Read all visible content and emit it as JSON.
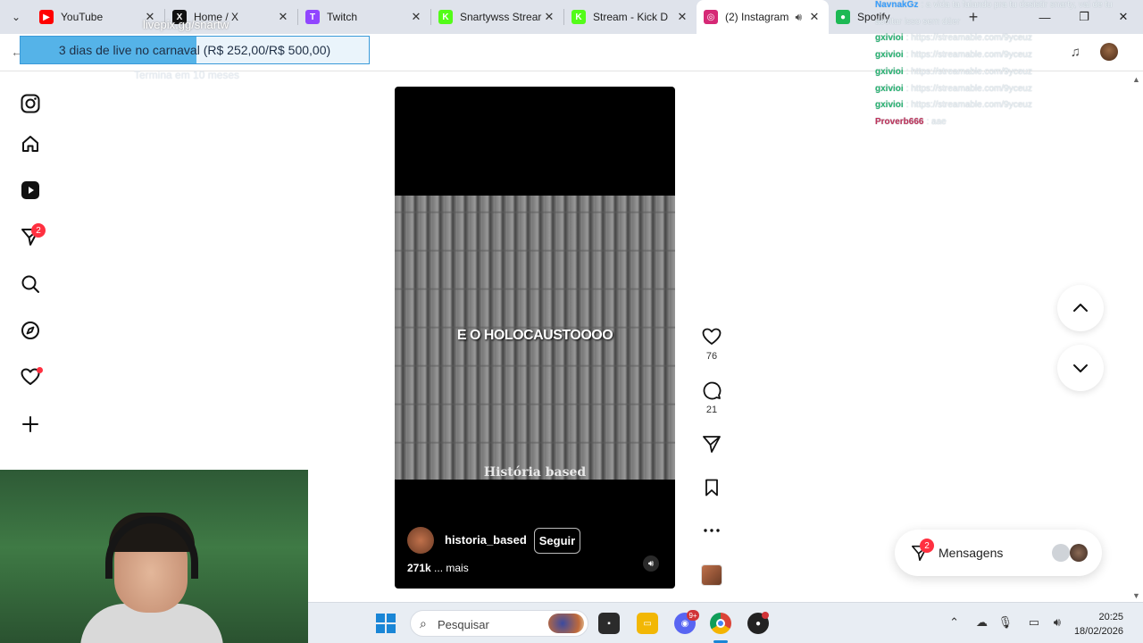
{
  "browser": {
    "tabs": [
      {
        "title": "YouTube",
        "color": "#ff0000",
        "glyph": "▶"
      },
      {
        "title": "Home / X",
        "color": "#111111",
        "glyph": "X"
      },
      {
        "title": "Twitch",
        "color": "#9146ff",
        "glyph": "T"
      },
      {
        "title": "Snartywss Strear",
        "color": "#53fc18",
        "glyph": "K"
      },
      {
        "title": "Stream - Kick D",
        "color": "#53fc18",
        "glyph": "K"
      },
      {
        "title": "(2) Instagram",
        "color": "#d62976",
        "glyph": "◎"
      },
      {
        "title": "Spotify",
        "color": "#1db954",
        "glyph": "●"
      }
    ],
    "active_tab_index": 5
  },
  "overlay": {
    "goal_text": "3 dias de live no carnaval (R$ 252,00/R$ 500,00)",
    "goal_progress": 0.504,
    "goal_sub": "Termina em 10 meses",
    "url_text": "livepix.gg/snartw",
    "goal_color": "#55b3e8"
  },
  "chat": [
    {
      "user": "NavnakGz",
      "text": "a vida ta falando pra tu desistir snarty, vai de tu",
      "color": "#3aa0ff"
    },
    {
      "user": "",
      "text": "aceitar isso sem dúer",
      "color": "#3aa0ff"
    },
    {
      "user": "gxivioi",
      "text": "https://streamable.com/9yceuz",
      "color": "#2bb673"
    },
    {
      "user": "gxivioi",
      "text": "https://streamable.com/9yceuz",
      "color": "#2bb673"
    },
    {
      "user": "gxivioi",
      "text": "https://streamable.com/9yceuz",
      "color": "#2bb673"
    },
    {
      "user": "gxivioi",
      "text": "https://streamable.com/9yceuz",
      "color": "#2bb673"
    },
    {
      "user": "gxivioi",
      "text": "https://streamable.com/9yceuz",
      "color": "#2bb673"
    },
    {
      "user": "Proverb666",
      "text": "aae",
      "color": "#c0325a"
    }
  ],
  "instagram": {
    "sidebar": [
      {
        "name": "instagram-logo-icon"
      },
      {
        "name": "home-icon"
      },
      {
        "name": "reels-icon"
      },
      {
        "name": "messages-icon",
        "badge": "2"
      },
      {
        "name": "search-icon"
      },
      {
        "name": "explore-icon"
      },
      {
        "name": "notifications-icon",
        "dot": true
      },
      {
        "name": "create-icon"
      }
    ],
    "reel": {
      "caption": "E O HOLOCAUSTOOOO",
      "watermark": "História based",
      "username": "historia_based",
      "follow_label": "Seguir",
      "desc_count": "271k",
      "desc_more": "... mais",
      "likes": "76",
      "comments": "21"
    },
    "messages": {
      "label": "Mensagens",
      "badge": "2"
    }
  },
  "taskbar": {
    "search_placeholder": "Pesquisar",
    "discord_badge": "9+",
    "time": "20:25",
    "date": "18/02/2026"
  }
}
